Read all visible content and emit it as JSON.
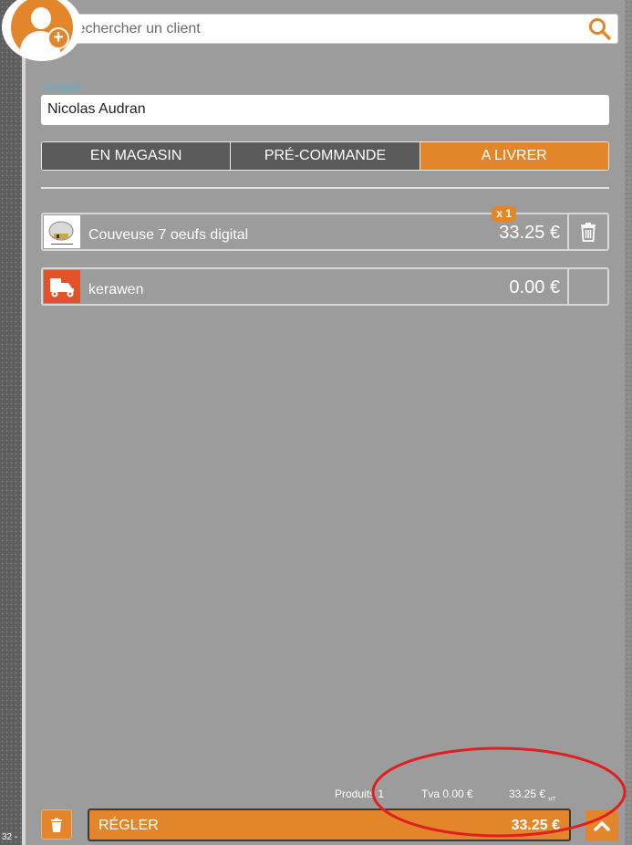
{
  "search": {
    "placeholder": "Rechercher un client"
  },
  "cashier": {
    "label": "CAISSIER",
    "value": "Nicolas Audran"
  },
  "tabs": [
    {
      "label": "EN MAGASIN",
      "active": false
    },
    {
      "label": "PRÉ-COMMANDE",
      "active": false
    },
    {
      "label": "A LIVRER",
      "active": true
    }
  ],
  "cart": {
    "items": [
      {
        "name": "Couveuse 7 oeufs digital",
        "price": "33.25 €",
        "quantity": "x 1",
        "icon": "product-thumbnail"
      },
      {
        "name": "kerawen",
        "price": "0.00 €",
        "icon": "delivery-scooter-icon"
      }
    ]
  },
  "totals": {
    "products": "Produits 1",
    "tva": "Tva 0.00 €",
    "total_ht": "33.25 €",
    "ht_suffix": "HT"
  },
  "footer": {
    "pay_label": "RÉGLER",
    "pay_amount": "33.25 €",
    "corner_label": "32 -"
  },
  "colors": {
    "accent": "#e3862b",
    "panel": "#9c9c9c",
    "tab_inactive": "#5a5a5a",
    "label_blue": "#4fb3d9",
    "annotation_red": "#e02020"
  }
}
